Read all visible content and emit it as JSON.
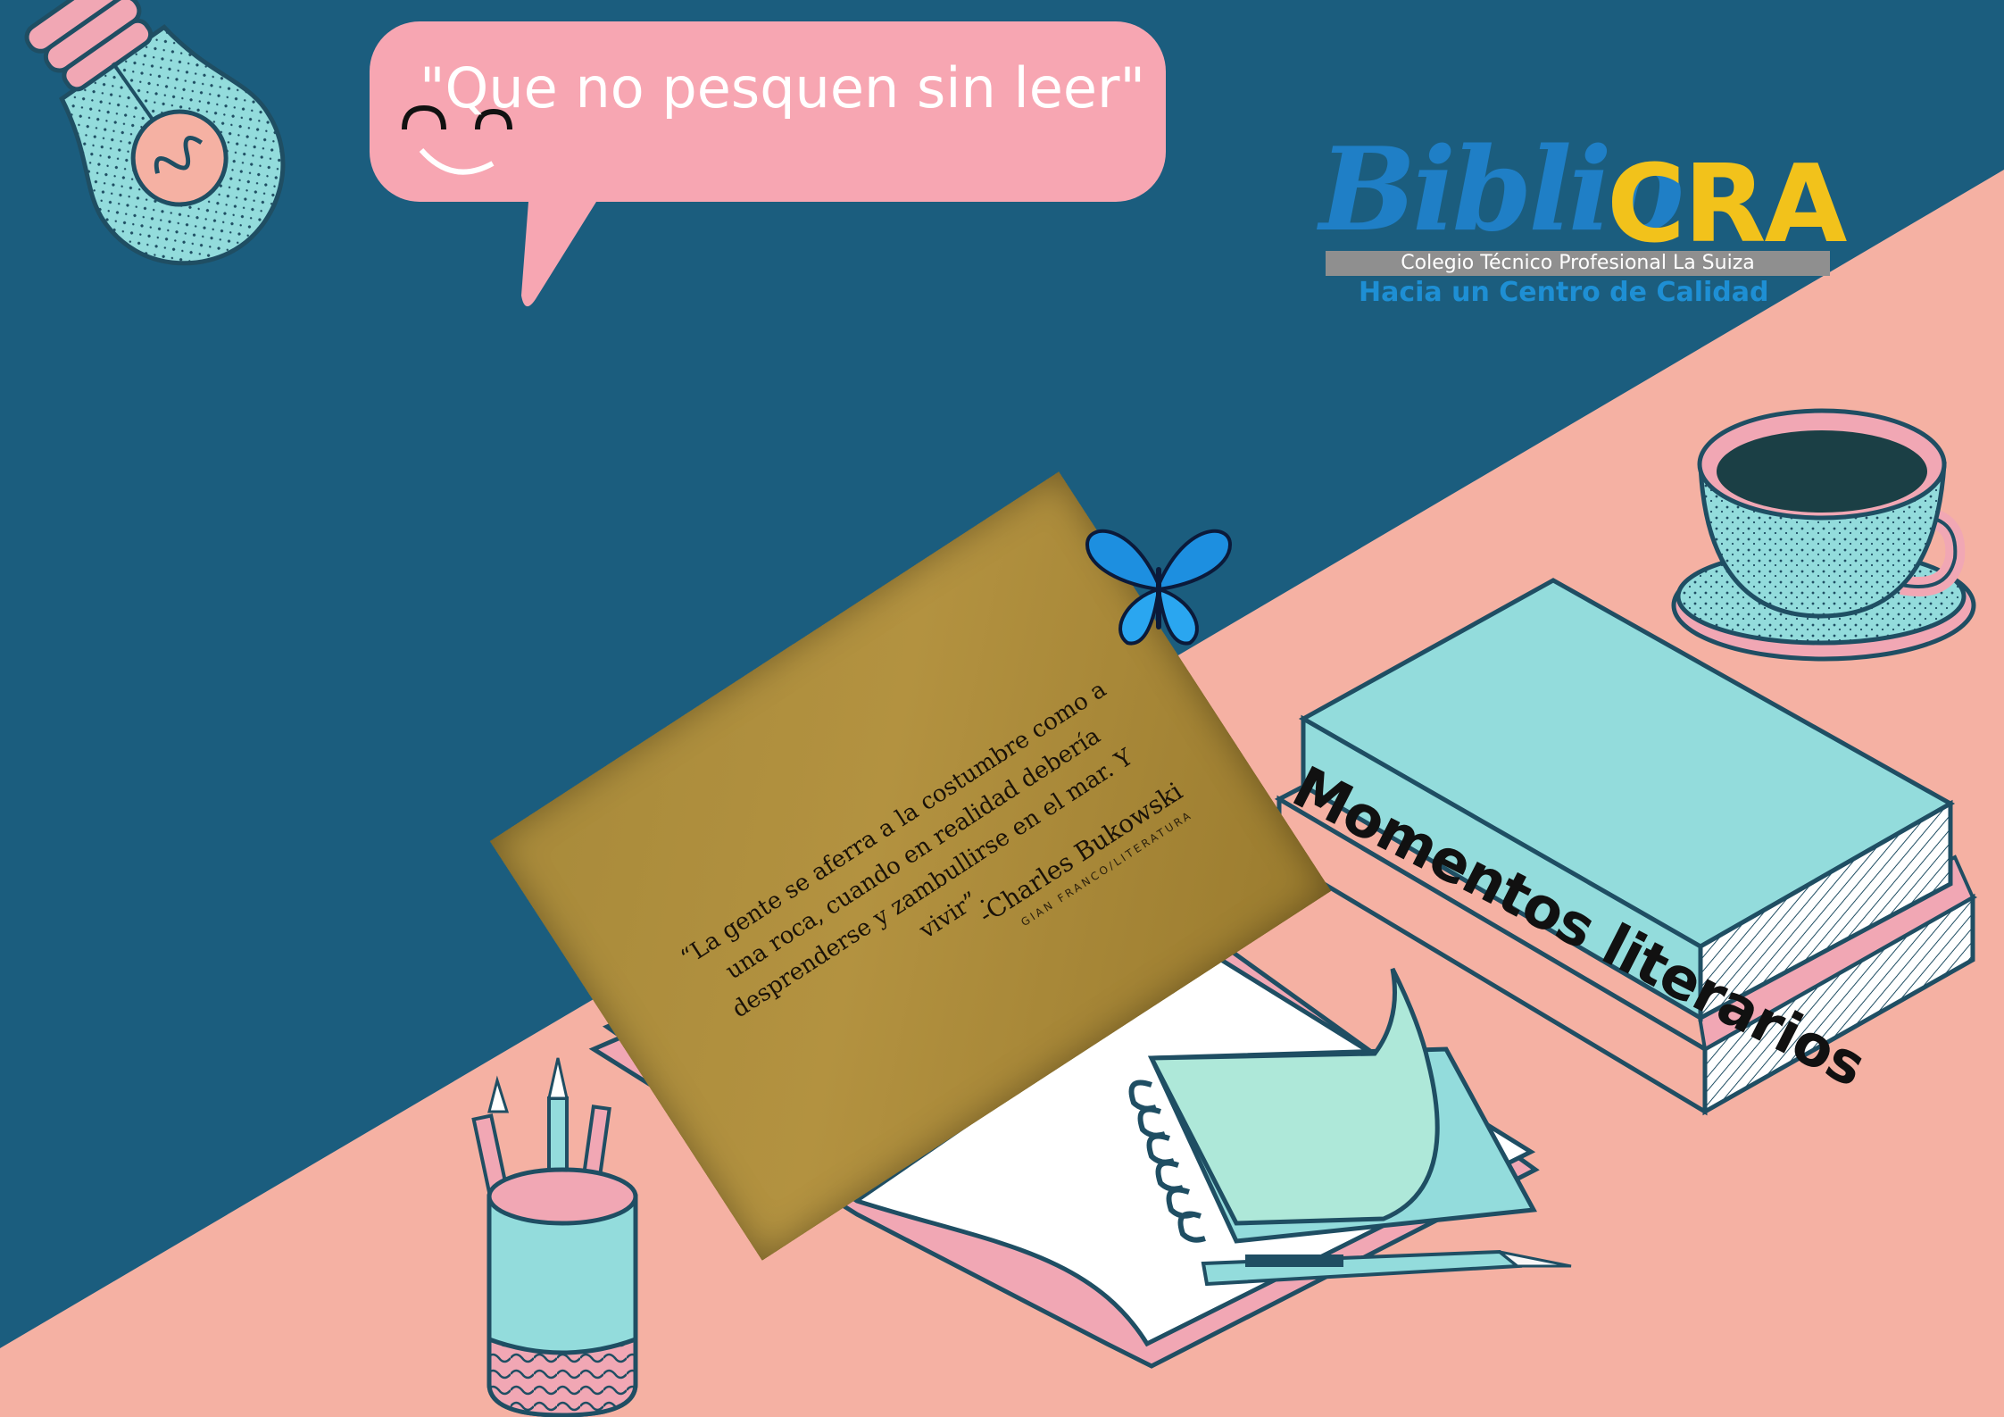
{
  "speech_bubble": {
    "text": "\"Que no pesquen sin leer\""
  },
  "logo": {
    "biblio": "Biblio",
    "cra": "CRA",
    "school": "Colegio Técnico Profesional La Suiza",
    "tagline": "Hacia un Centro de Calidad"
  },
  "quote_note": {
    "quote": "“La gente se aferra a la costumbre como a una roca, cuando en realidad debería desprenderse y zambullirse en el mar. Y vivir”.",
    "author": "-Charles Bukowski",
    "credit": "GIAN FRANCO/LITERATURA"
  },
  "book": {
    "title": "Momentos literarios"
  },
  "colors": {
    "navy": "#1b5d7e",
    "peach": "#f5b1a3",
    "aqua": "#93dcdc",
    "pink": "#f1a7b4",
    "dark": "#1f4e63"
  },
  "icons": [
    "lightbulb-icon",
    "smiley-icon",
    "butterfly-icon",
    "coffee-cup-icon",
    "pencil-cup-icon",
    "notebook-icon",
    "spiral-notepad-icon",
    "pen-icon",
    "book-stack-icon"
  ]
}
